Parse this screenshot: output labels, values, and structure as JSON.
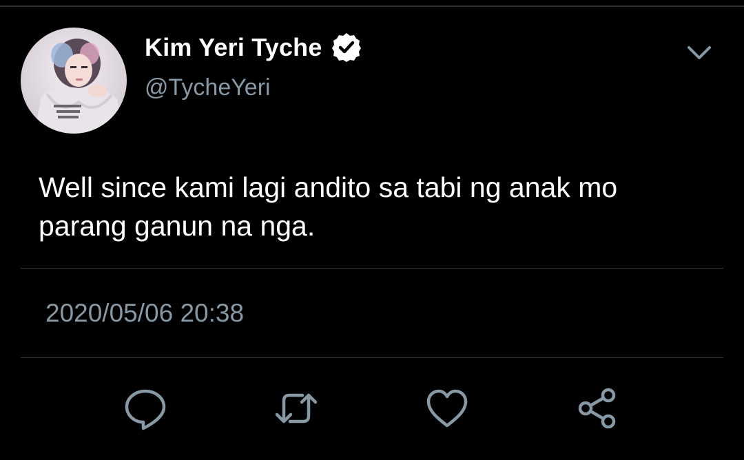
{
  "tweet": {
    "author": {
      "display_name": "Kim Yeri Tyche",
      "handle": "@TycheYeri",
      "verified": true,
      "avatar": "profile-photo"
    },
    "text": "Well since kami lagi andito sa tabi ng anak mo\nparang ganun na nga.",
    "timestamp": "2020/05/06 20:38"
  },
  "actions": [
    {
      "icon": "reply-icon"
    },
    {
      "icon": "retweet-icon"
    },
    {
      "icon": "like-icon"
    },
    {
      "icon": "share-icon"
    }
  ],
  "menu": {
    "icon": "chevron-down-icon"
  },
  "colors": {
    "background": "#000000",
    "primary_text": "#ffffff",
    "secondary_text": "#8899a6",
    "divider": "#2f3336",
    "icon": "#8899a6"
  }
}
